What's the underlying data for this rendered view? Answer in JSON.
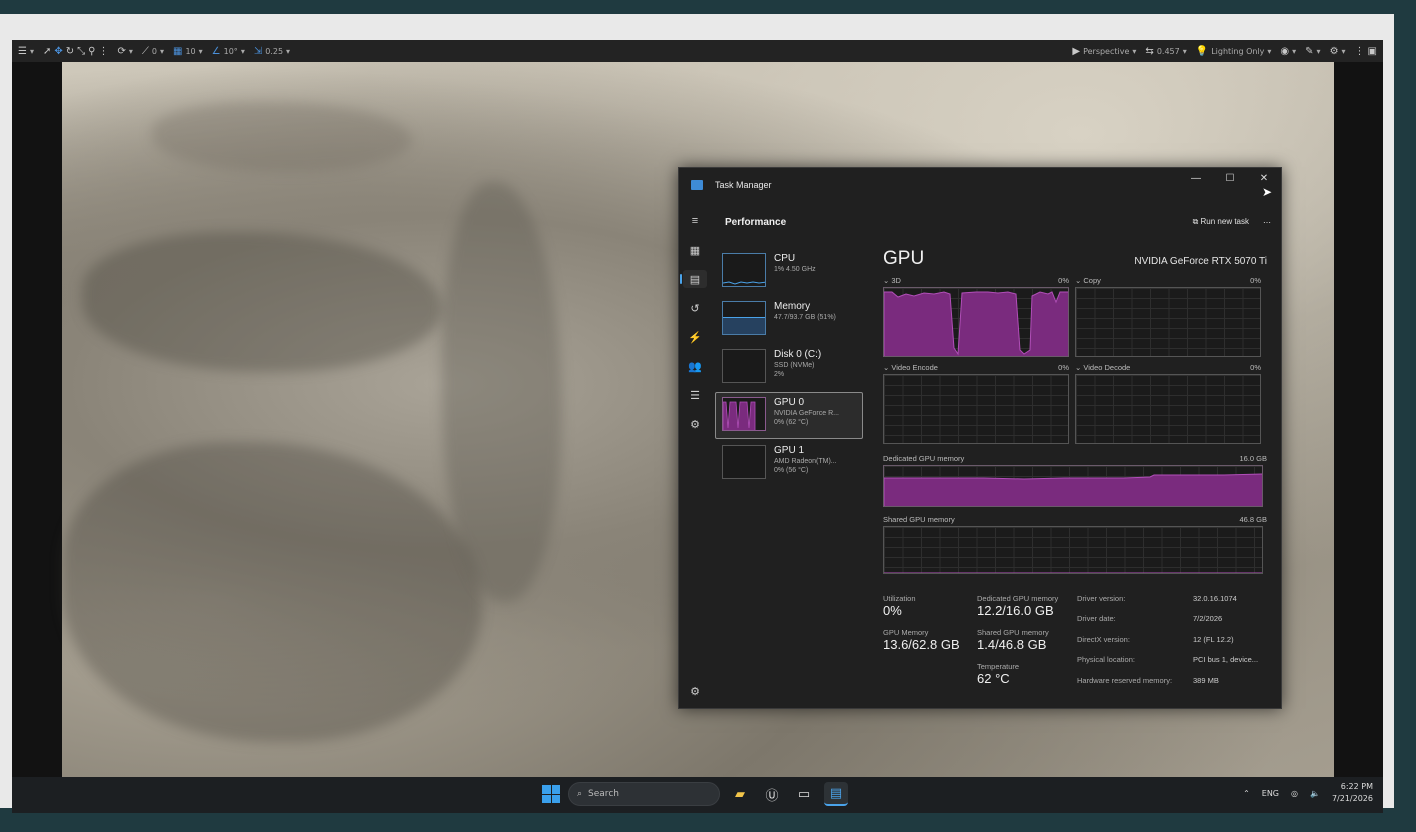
{
  "ue_toolbar": {
    "snap_rot": "0",
    "snap_grid": "10",
    "snap_angle": "10°",
    "snap_scale": "0.25",
    "viewport_mode": "Perspective",
    "camera_speed": "0.457",
    "view_mode": "Lighting Only"
  },
  "task_manager": {
    "title": "Task Manager",
    "section": "Performance",
    "run_new_task": "Run new task",
    "list": [
      {
        "name": "CPU",
        "line1": "1% 4.50 GHz",
        "line2": ""
      },
      {
        "name": "Memory",
        "line1": "47.7/93.7 GB (51%)",
        "line2": ""
      },
      {
        "name": "Disk 0 (C:)",
        "line1": "SSD (NVMe)",
        "line2": "2%"
      },
      {
        "name": "GPU 0",
        "line1": "NVIDIA GeForce R...",
        "line2": "0% (62 °C)"
      },
      {
        "name": "GPU 1",
        "line1": "AMD Radeon(TM)...",
        "line2": "0% (56 °C)"
      }
    ],
    "gpu": {
      "heading": "GPU",
      "model": "NVIDIA GeForce RTX 5070 Ti",
      "graph_3d": "3D",
      "graph_3d_pct": "0%",
      "graph_copy": "Copy",
      "graph_copy_pct": "0%",
      "graph_encode": "Video Encode",
      "graph_encode_pct": "0%",
      "graph_decode": "Video Decode",
      "graph_decode_pct": "0%",
      "dedicated_label": "Dedicated GPU memory",
      "dedicated_max": "16.0 GB",
      "shared_label": "Shared GPU memory",
      "shared_max": "46.8 GB",
      "util_label": "Utilization",
      "util_value": "0%",
      "gpumem_label": "GPU Memory",
      "gpumem_value": "13.6/62.8 GB",
      "ded_label": "Dedicated GPU memory",
      "ded_value": "12.2/16.0 GB",
      "sh_label": "Shared GPU memory",
      "sh_value": "1.4/46.8 GB",
      "temp_label": "Temperature",
      "temp_value": "62 °C",
      "driver_version_label": "Driver version:",
      "driver_version": "32.0.16.1074",
      "driver_date_label": "Driver date:",
      "driver_date": "7/2/2026",
      "directx_label": "DirectX version:",
      "directx": "12 (FL 12.2)",
      "location_label": "Physical location:",
      "location": "PCI bus 1, device...",
      "reserved_label": "Hardware reserved memory:",
      "reserved": "389 MB"
    }
  },
  "taskbar": {
    "search_placeholder": "Search",
    "lang": "ENG",
    "time": "6:22 PM",
    "date": "7/21/2026"
  },
  "colors": {
    "accent": "#4aa3ea",
    "gpu_purple": "#7a2b7e",
    "gpu_line": "#b14fb8"
  }
}
